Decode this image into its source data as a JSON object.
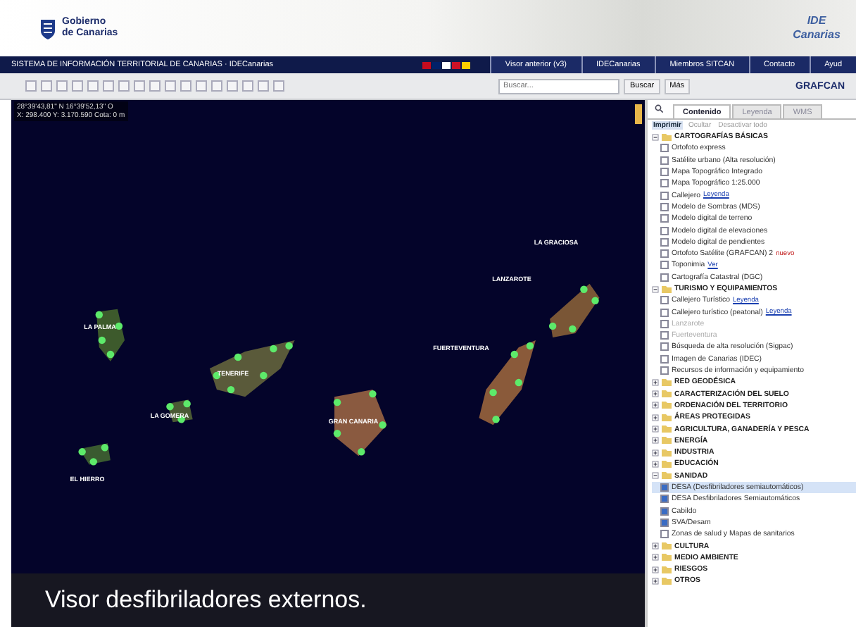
{
  "header": {
    "logo_text": "Gobierno de Canarias",
    "ide_text": "IDE Canarias"
  },
  "navbar": {
    "title": "SISTEMA DE INFORMACIÓN TERRITORIAL DE CANARIAS · IDECanarias",
    "links": [
      "Visor anterior (v3)",
      "IDECanarias",
      "Miembros SITCAN",
      "Contacto",
      "Ayud"
    ]
  },
  "toolbar": {
    "search": {
      "placeholder": "Buscar..."
    },
    "buttons": [
      "Buscar",
      "Más"
    ],
    "brand": "GRAFCAN"
  },
  "map": {
    "coordinates": [
      "28°39'43,81\" N 16°39'52,13\" O",
      "X: 298.400  Y: 3.170.590  Cota: 0 m"
    ],
    "labels": [
      "LA GRACIOSA",
      "LANZAROTE",
      "LA PALMA",
      "FUERTEVENTURA",
      "TENERIFE",
      "LA GOMERA",
      "GRAN CANARIA",
      "EL HIERRO"
    ]
  },
  "panel": {
    "tabs": [
      {
        "label": "Contenido",
        "selected": true
      },
      {
        "label": "Leyenda",
        "selected": false
      },
      {
        "label": "WMS",
        "selected": false
      }
    ],
    "subtabs": [
      {
        "label": "Imprimir",
        "selected": true
      },
      {
        "label": "Ocultar",
        "selected": false
      },
      {
        "label": "Desactivar todo",
        "selected": false
      }
    ],
    "tree": [
      {
        "kind": "folder",
        "label": "CARTOGRAFÍAS BÁSICAS",
        "expanded": true,
        "children": [
          {
            "kind": "layer",
            "label": "Ortofoto express",
            "checked": false
          },
          {
            "kind": "layer",
            "label": "Satélite urbano (Alta resolución)",
            "checked": false
          },
          {
            "kind": "layer",
            "label": "Mapa Topográfico Integrado",
            "checked": false
          },
          {
            "kind": "layer",
            "label": "Mapa Topográfico 1:25.000",
            "checked": false
          },
          {
            "kind": "layer",
            "label": "Callejero",
            "checked": false,
            "link": "Leyenda"
          },
          {
            "kind": "layer",
            "label": "Modelo de Sombras (MDS)",
            "checked": false
          },
          {
            "kind": "layer",
            "label": "Modelo digital de terreno",
            "checked": false
          },
          {
            "kind": "layer",
            "label": "Modelo digital de elevaciones",
            "checked": false
          },
          {
            "kind": "layer",
            "label": "Modelo digital de pendientes",
            "checked": false
          },
          {
            "kind": "layer",
            "label": "Ortofoto Satélite (GRAFCAN) 2",
            "checked": false,
            "badge": "nuevo"
          },
          {
            "kind": "layer",
            "label": "Toponimia",
            "checked": false,
            "link": "Ver"
          },
          {
            "kind": "layer",
            "label": "Cartografía Catastral (DGC)",
            "checked": false
          }
        ]
      },
      {
        "kind": "folder",
        "label": "TURISMO Y EQUIPAMIENTOS",
        "expanded": true,
        "children": [
          {
            "kind": "layer",
            "label": "Callejero Turístico",
            "checked": false,
            "link": "Leyenda"
          },
          {
            "kind": "layer",
            "label": "Callejero turístico (peatonal)",
            "checked": false,
            "link": "Leyenda"
          },
          {
            "kind": "layer",
            "label": "Lanzarote",
            "checked": false,
            "disabled": true
          },
          {
            "kind": "layer",
            "label": "Fuerteventura",
            "checked": false,
            "disabled": true
          },
          {
            "kind": "layer",
            "label": "Búsqueda de alta resolución (Sigpac)",
            "checked": false
          },
          {
            "kind": "layer",
            "label": "Imagen de Canarias (IDEC)",
            "checked": false
          },
          {
            "kind": "layer",
            "label": "Recursos de información y equipamiento",
            "checked": false
          }
        ]
      },
      {
        "kind": "folder",
        "label": "RED GEODÉSICA",
        "expanded": false
      },
      {
        "kind": "folder",
        "label": "CARACTERIZACIÓN DEL SUELO",
        "expanded": false
      },
      {
        "kind": "folder",
        "label": "ORDENACIÓN DEL TERRITORIO",
        "expanded": false
      },
      {
        "kind": "folder",
        "label": "ÁREAS PROTEGIDAS",
        "expanded": false
      },
      {
        "kind": "folder",
        "label": "AGRICULTURA, GANADERÍA Y PESCA",
        "expanded": false
      },
      {
        "kind": "folder",
        "label": "ENERGÍA",
        "expanded": false
      },
      {
        "kind": "folder",
        "label": "INDUSTRIA",
        "expanded": false
      },
      {
        "kind": "folder",
        "label": "EDUCACIÓN",
        "expanded": false
      },
      {
        "kind": "folder",
        "label": "SANIDAD",
        "expanded": true,
        "children": [
          {
            "kind": "layer",
            "label": "DESA (Desfibriladores semiautomáticos)",
            "checked": true,
            "selected": true
          },
          {
            "kind": "layer",
            "label": "DESA Desfibriladores Semiautomáticos",
            "checked": true
          },
          {
            "kind": "layer",
            "label": "Cabildo",
            "checked": true
          },
          {
            "kind": "layer",
            "label": "SVA/Desam",
            "checked": true
          },
          {
            "kind": "layer",
            "label": "Zonas de salud y Mapas de sanitarios",
            "checked": false
          }
        ]
      },
      {
        "kind": "folder",
        "label": "CULTURA",
        "expanded": false
      },
      {
        "kind": "folder",
        "label": "MEDIO AMBIENTE",
        "expanded": false
      },
      {
        "kind": "folder",
        "label": "RIESGOS",
        "expanded": false
      },
      {
        "kind": "folder",
        "label": "OTROS",
        "expanded": false
      }
    ]
  },
  "caption": "Visor desfibriladores externos."
}
